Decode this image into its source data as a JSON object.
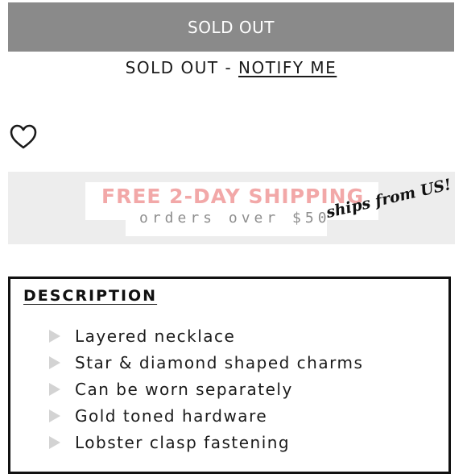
{
  "soldout_button": {
    "label": "SOLD OUT"
  },
  "notify": {
    "prefix": "SOLD OUT - ",
    "link": "NOTIFY ME"
  },
  "wishlist": {
    "icon": "heart-outline-icon"
  },
  "promo": {
    "title": "FREE 2-DAY SHIPPING",
    "subtitle": "orders over $50",
    "script": "ships from US!",
    "colors": {
      "title": "#f2a8a8",
      "subtitle": "#8e8e8e",
      "background": "#ededed"
    }
  },
  "description": {
    "title": "DESCRIPTION",
    "items": [
      {
        "text": "Layered necklace"
      },
      {
        "text": "Star & diamond shaped charms"
      },
      {
        "text": "Can be worn separately"
      },
      {
        "text": "Gold toned hardware"
      },
      {
        "text": "Lobster clasp fastening"
      }
    ]
  },
  "colors": {
    "soldout_bar": "#8a8a8a",
    "text": "#1a1a1a",
    "bullet": "#d3d3d3"
  }
}
